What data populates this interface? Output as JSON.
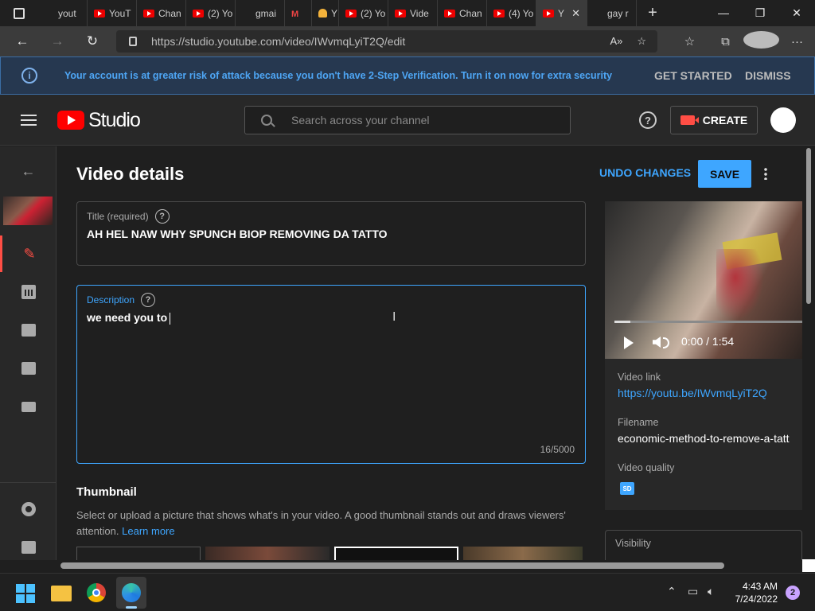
{
  "browser": {
    "tabs": [
      {
        "label": "yout",
        "favicon": "search-icon"
      },
      {
        "label": "YouT",
        "favicon": "youtube-icon"
      },
      {
        "label": "Chan",
        "favicon": "youtube-icon"
      },
      {
        "label": "(2) Yo",
        "favicon": "youtube-icon"
      },
      {
        "label": "gmai",
        "favicon": "search-icon"
      },
      {
        "label": "M",
        "favicon": "gmail-icon"
      },
      {
        "label": "Y",
        "favicon": "bell-icon"
      },
      {
        "label": "(2) Yo",
        "favicon": "youtube-icon"
      },
      {
        "label": "Vide",
        "favicon": "youtube-icon"
      },
      {
        "label": "Chan",
        "favicon": "youtube-icon"
      },
      {
        "label": "(4) Yo",
        "favicon": "youtube-icon"
      },
      {
        "label": "Y",
        "favicon": "youtube-icon",
        "active": true
      },
      {
        "label": "gay r",
        "favicon": "search-icon"
      }
    ],
    "url": "https://studio.youtube.com/video/IWvmqLyiT2Q/edit"
  },
  "banner": {
    "message": "Your account is at greater risk of attack because you don't have 2-Step Verification. Turn it on now for extra security",
    "get_started": "GET STARTED",
    "dismiss": "DISMISS"
  },
  "header": {
    "brand": "Studio",
    "search_placeholder": "Search across your channel",
    "create_label": "CREATE"
  },
  "page": {
    "title": "Video details",
    "undo_label": "UNDO CHANGES",
    "save_label": "SAVE"
  },
  "form": {
    "title_label": "Title (required)",
    "title_value": "AH HEL NAW WHY SPUNCH BIOP REMOVING DA TATTO",
    "description_label": "Description",
    "description_value": "we need you to",
    "description_counter": "16/5000",
    "thumbnail_heading": "Thumbnail",
    "thumbnail_text": "Select or upload a picture that shows what's in your video. A good thumbnail stands out and draws viewers' attention.",
    "learn_more": "Learn more"
  },
  "video": {
    "time": "0:00 / 1:54",
    "progress": 0.0,
    "link_label": "Video link",
    "link": "https://youtu.be/IWvmqLyiT2Q",
    "filename_label": "Filename",
    "filename": "economic-method-to-remove-a-tatt",
    "quality_label": "Video quality",
    "quality_badge": "SD",
    "visibility_label": "Visibility"
  },
  "taskbar": {
    "time": "4:43 AM",
    "date": "7/24/2022",
    "notifications": "2"
  },
  "colors": {
    "accent": "#3ea6ff",
    "brand_red": "#ff0000",
    "background": "#1f1f1f"
  }
}
